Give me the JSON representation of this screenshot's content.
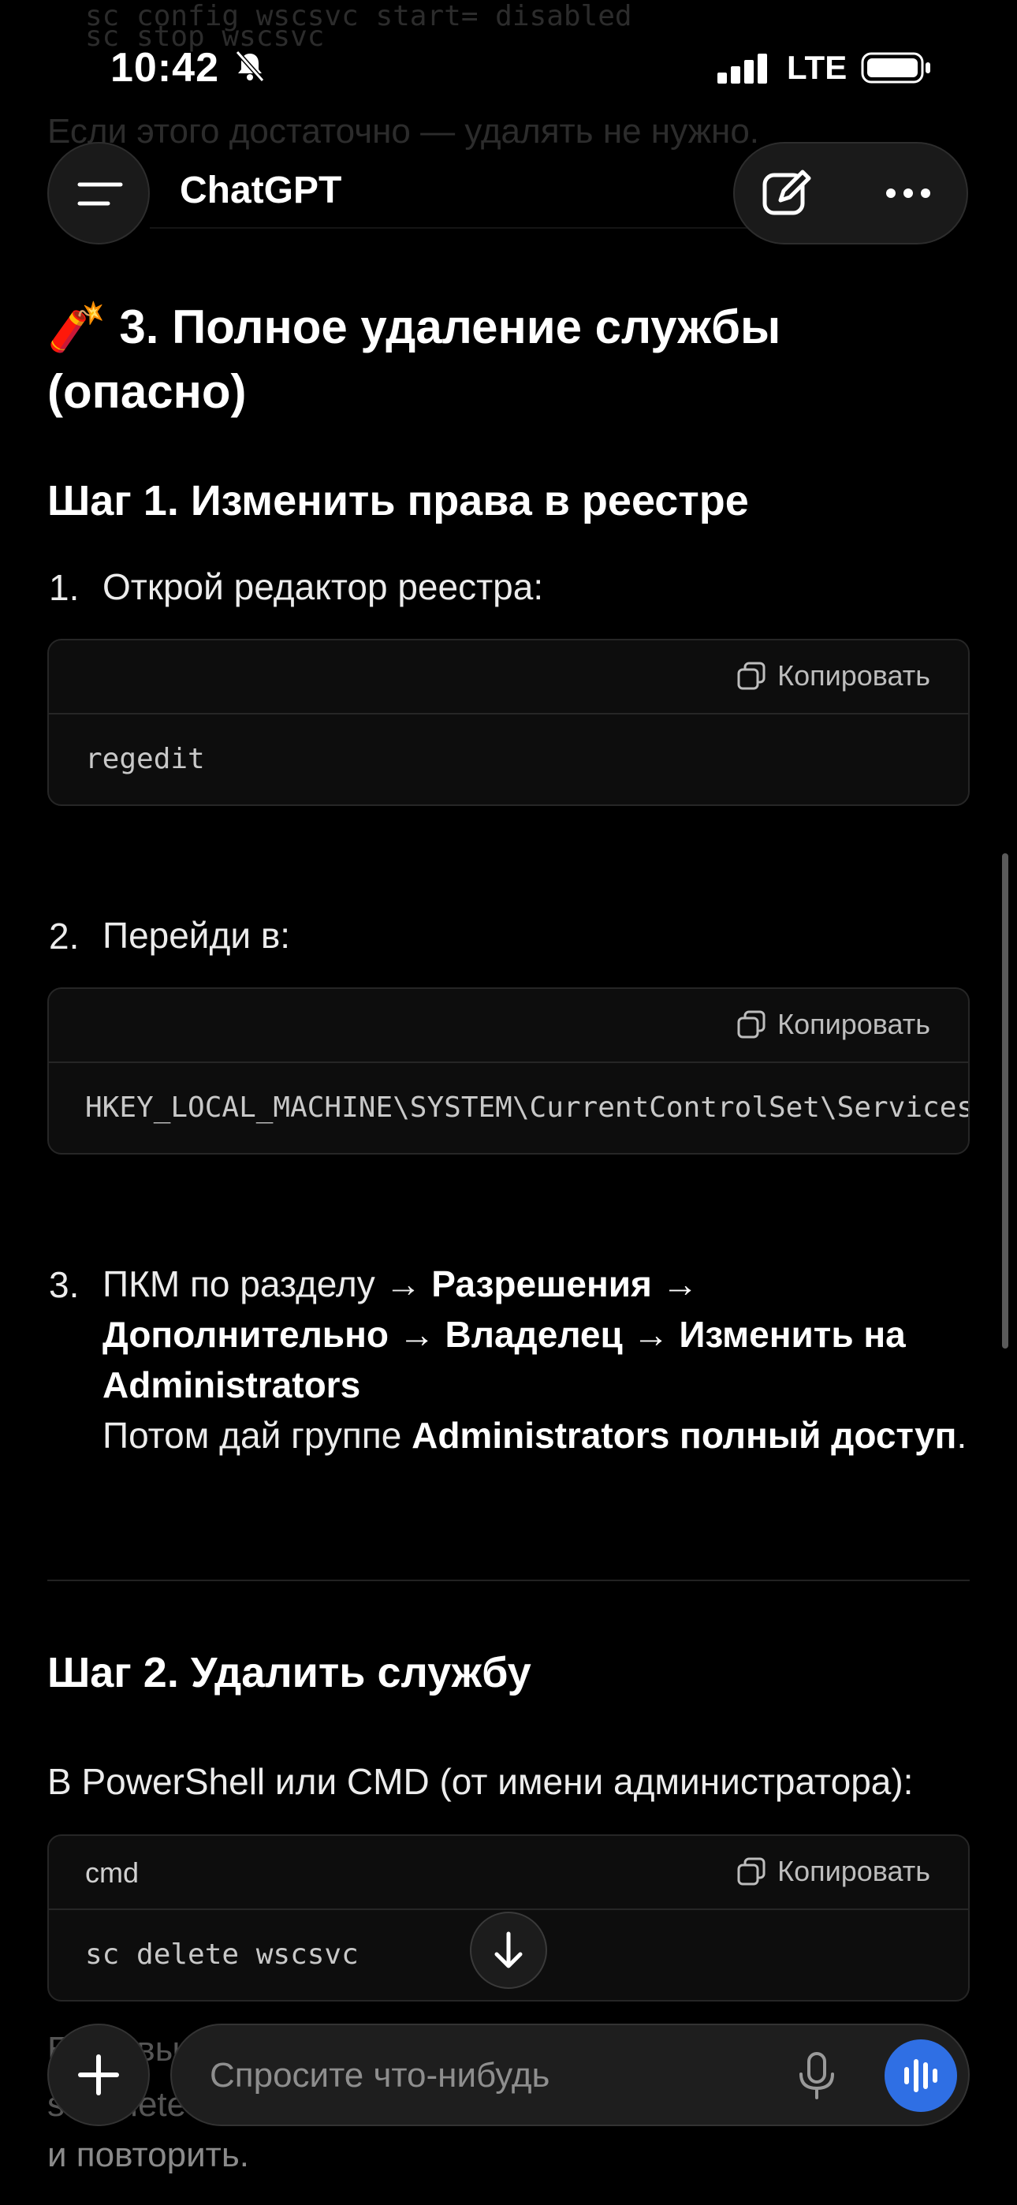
{
  "status_bar": {
    "time": "10:42",
    "network": "LTE"
  },
  "header": {
    "title": "ChatGPT"
  },
  "faded_lines": [
    "sc config wscsvc start= disabled",
    "sc stop wscsvc",
    "Если этого достаточно — удалять не нужно."
  ],
  "section": {
    "emoji": "🧨",
    "title": "3. Полное удаление службы (опасно)"
  },
  "step1": {
    "heading": "Шаг 1. Изменить права в реестре",
    "items": [
      {
        "num": "1.",
        "text": "Открой редактор реестра:"
      },
      {
        "num": "2.",
        "text": "Перейди в:"
      },
      {
        "num": "3."
      }
    ],
    "item3": {
      "a": "ПКМ по разделу → ",
      "b": "Разрешения → Дополнительно → Владелец → Изменить на Administrators",
      "c": "Потом дай группе ",
      "d": "Administrators полный доступ",
      "e": "."
    }
  },
  "code_blocks": [
    {
      "lang": "",
      "copy_label": "Копировать",
      "code": "regedit"
    },
    {
      "lang": "",
      "copy_label": "Копировать",
      "code": "HKEY_LOCAL_MACHINE\\SYSTEM\\CurrentControlSet\\Services\\wscsvc"
    },
    {
      "lang": "cmd",
      "copy_label": "Копировать",
      "code": "sc delete wscsvc"
    }
  ],
  "step2": {
    "heading": "Шаг 2. Удалить службу",
    "intro": "В PowerShell или CMD (от имени администратора):"
  },
  "bottom_faded": [
    "Если выдаст ошибку доступа Denied — или специально",
    "sc delete снова после перезагрузки",
    "и повторить."
  ],
  "composer": {
    "placeholder": "Спросите что-нибудь"
  }
}
